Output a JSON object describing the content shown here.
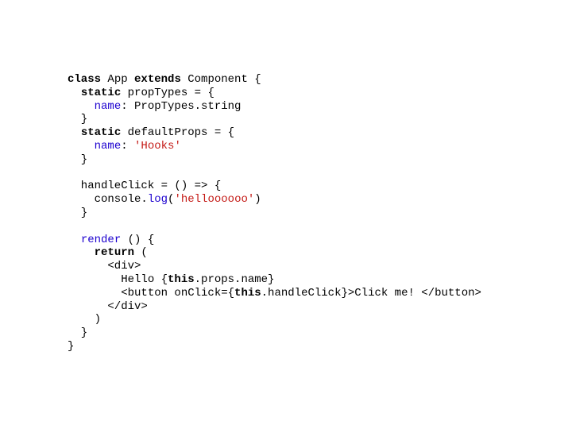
{
  "code": {
    "kw_class": "class",
    "app": " App ",
    "kw_extends": "extends",
    "component": " Component {",
    "kw_static1": "static",
    "propTypes": " propTypes = {",
    "name1": "name",
    "propTypesString": ": PropTypes.string",
    "closeBrace1": "  }",
    "kw_static2": "static",
    "defaultProps": " defaultProps = {",
    "name2": "name",
    "colon1": ": ",
    "hooksStr": "'Hooks'",
    "closeBrace2": "  }",
    "handleClick": "  handleClick = () => {",
    "consoleDot": "    console.",
    "log": "log",
    "openParen1": "(",
    "helloStr": "'helloooooo'",
    "closeParen1": ")",
    "closeBrace3": "  }",
    "render": "render",
    "renderParen": " () {",
    "kw_return": "return",
    "returnParen": " (",
    "divOpen": "      <div>",
    "helloText": "        Hello {",
    "kw_this1": "this",
    "propsName": ".props.name}",
    "buttonOpen": "        <button onClick={",
    "kw_this2": "this",
    "handleClickRef": ".handleClick}>Click me! </button>",
    "divClose": "      </div>",
    "closeParen2": "    )",
    "closeBrace4": "  }",
    "closeBrace5": "}"
  }
}
